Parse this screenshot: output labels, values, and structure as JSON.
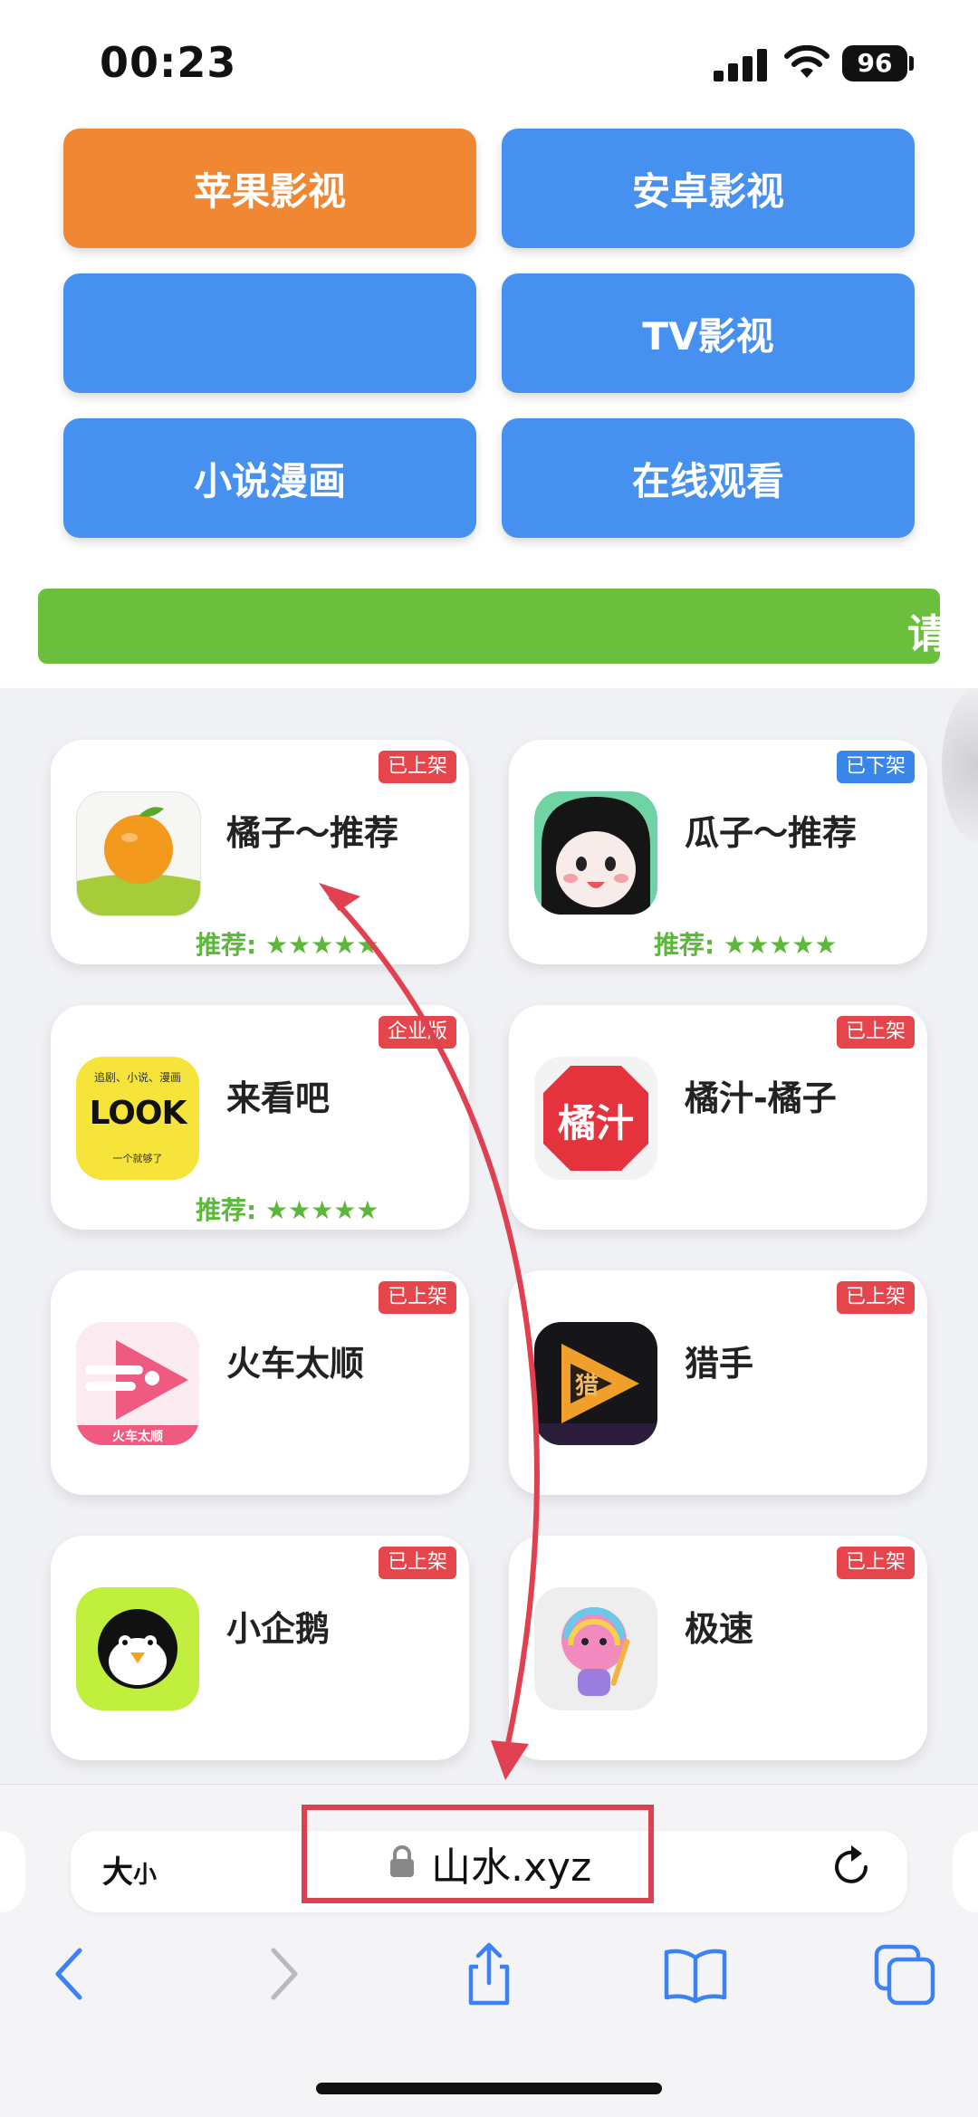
{
  "status_bar": {
    "time": "00:23",
    "battery": "96"
  },
  "buttons": [
    {
      "label": "苹果影视",
      "color": "#ef8733"
    },
    {
      "label": "安卓影视",
      "color": "#4690f0"
    },
    {
      "label": "",
      "color": "#4690f0"
    },
    {
      "label": "TV影视",
      "color": "#4690f0"
    },
    {
      "label": "小说漫画",
      "color": "#4690f0"
    },
    {
      "label": "在线观看",
      "color": "#4690f0"
    }
  ],
  "marquee": {
    "text": "请"
  },
  "apps": [
    {
      "name": "橘子～推荐",
      "badge": "已上架",
      "badge_color": "#e5464b",
      "rating": "推荐: ★★★★★",
      "icon": "orange-app-icon"
    },
    {
      "name": "瓜子～推荐",
      "badge": "已下架",
      "badge_color": "#3a86e8",
      "rating": "推荐: ★★★★★",
      "icon": "guazi-app-icon"
    },
    {
      "name": "来看吧",
      "badge": "企业版",
      "badge_color": "#e5464b",
      "rating": "推荐: ★★★★★",
      "icon": "look-app-icon",
      "icon_text_top": "追剧、小说、漫画",
      "icon_text_main": "LOOK",
      "icon_text_bottom": "一个就够了"
    },
    {
      "name": "橘汁-橘子",
      "badge": "已上架",
      "badge_color": "#e5464b",
      "icon": "juzhi-app-icon",
      "icon_text_main": "橘汁"
    },
    {
      "name": "火车太顺",
      "badge": "已上架",
      "badge_color": "#e5464b",
      "icon": "train-app-icon",
      "icon_text_bottom": "火车太顺"
    },
    {
      "name": "猎手",
      "badge": "已上架",
      "badge_color": "#e5464b",
      "icon": "hunter-app-icon",
      "icon_text_main": "猎"
    },
    {
      "name": "小企鹅",
      "badge": "已上架",
      "badge_color": "#e5464b",
      "icon": "penguin-app-icon"
    },
    {
      "name": "极速",
      "badge": "已上架",
      "badge_color": "#e5464b",
      "icon": "jisu-app-icon"
    }
  ],
  "browser": {
    "text_size_label": "大",
    "text_size_small": "小",
    "url": "山水.xyz"
  },
  "colors": {
    "accent_blue": "#4690f0",
    "accent_orange": "#ef8733",
    "green": "#6bbf3c",
    "annotation_red": "#dd4051"
  }
}
